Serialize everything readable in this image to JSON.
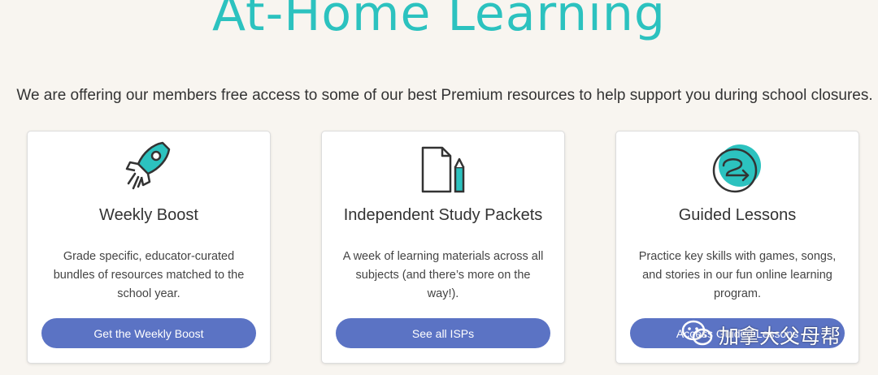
{
  "hero": {
    "title": "At-Home Learning"
  },
  "intro": "We are offering our members free access to some of our best Premium resources to help support you during school closures.",
  "cards": [
    {
      "icon": "rocket-icon",
      "title": "Weekly Boost",
      "description": "Grade specific, educator-curated bundles of resources matched to the school year.",
      "button": "Get the Weekly Boost"
    },
    {
      "icon": "document-pencil-icon",
      "title": "Independent Study Packets",
      "description": "A week of learning materials across all subjects (and there’s more on the way!).",
      "button": "See all ISPs"
    },
    {
      "icon": "guided-path-icon",
      "title": "Guided Lessons",
      "description": "Practice key skills with games, songs, and stories in our fun online learning program.",
      "button": "Access Guided Lessons"
    }
  ],
  "watermark": {
    "icon": "wechat-icon",
    "text": "加拿大父母帮"
  },
  "colors": {
    "accent": "#2cc2bf",
    "button": "#5b73c4",
    "background": "#f8f5f0"
  }
}
